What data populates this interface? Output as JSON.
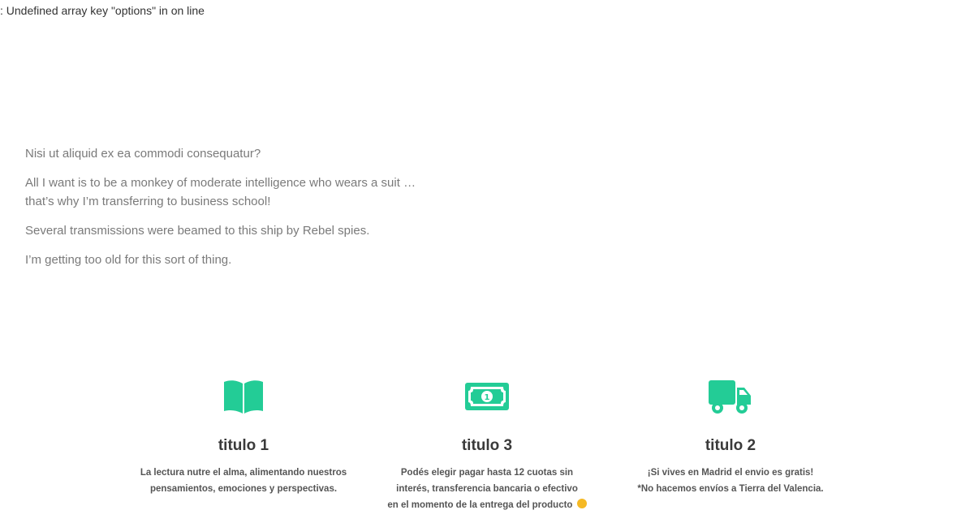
{
  "warning": {
    "text": ": Undefined array key \"options\" in on line"
  },
  "quotes": [
    "Nisi ut aliquid ex ea commodi consequatur?",
    "All I want is to be a monkey of moderate intelligence who wears a suit …",
    "that’s why I’m transferring to business school!",
    "Several transmissions were beamed to this ship by Rebel spies.",
    "I’m getting too old for this sort of thing."
  ],
  "features": [
    {
      "icon": "open-book-icon",
      "title": "titulo 1",
      "lines": [
        "La lectura nutre el alma, alimentando nuestros",
        "pensamientos, emociones y perspectivas."
      ]
    },
    {
      "icon": "money-bill-icon",
      "title": "titulo 3",
      "lines": [
        "Podés elegir pagar hasta 12 cuotas sin",
        "interés, transferencia bancaria o efectivo",
        "en el momento de la entrega del producto"
      ],
      "emoji": "smiley-emoji-icon"
    },
    {
      "icon": "delivery-truck-icon",
      "title": "titulo 2",
      "lines": [
        "¡Si vives en Madrid el envio es gratis!",
        "*No hacemos envíos a Tierra del Valencia."
      ]
    }
  ],
  "colors": {
    "accent": "#23cc96",
    "title": "#3a3a3a",
    "body_text": "#7a7a7a"
  }
}
